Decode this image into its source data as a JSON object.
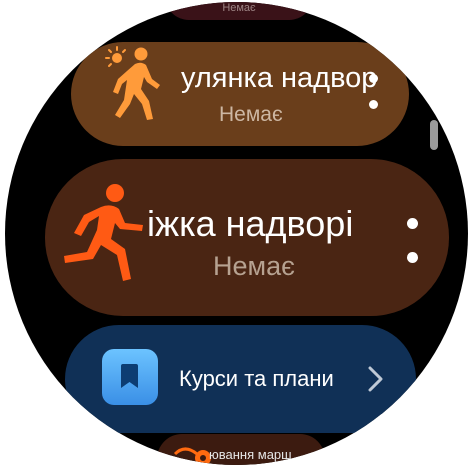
{
  "cards": [
    {
      "id": "top",
      "subtitle": "Немає"
    },
    {
      "id": "walk",
      "title": "улянка надвор",
      "subtitle": "Немає",
      "icon": "walking-person-sun-icon",
      "accent": "#ff8a2a"
    },
    {
      "id": "run",
      "title": "іжка надворі",
      "subtitle": "Немає",
      "icon": "running-person-icon",
      "accent": "#ff5a14"
    },
    {
      "id": "courses",
      "title": "Курси та плани",
      "icon": "bookmark-icon",
      "chevron": "chevron-right-icon",
      "accent": "#4aa8ff"
    },
    {
      "id": "route",
      "title": "ювання марш",
      "icon": "route-icon",
      "accent": "#ff6a10"
    }
  ]
}
